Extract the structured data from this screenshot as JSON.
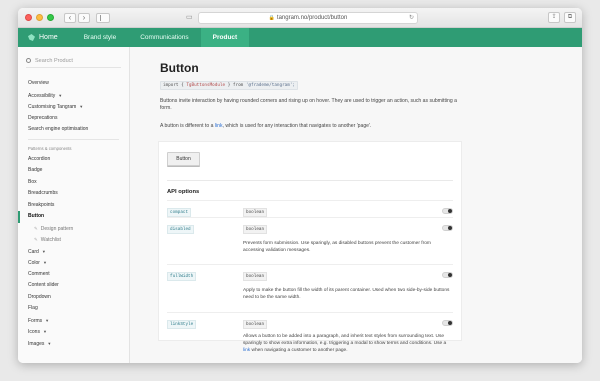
{
  "browser": {
    "url": "tangram.no/product/button"
  },
  "appnav": {
    "items": [
      "Home",
      "Brand style",
      "Communications",
      "Product"
    ],
    "active": "Product"
  },
  "sidebar": {
    "search_placeholder": "Search Product",
    "top_items": [
      "Overview",
      "Accessibility",
      "Customising Tangram",
      "Deprecations",
      "Search engine optimisation"
    ],
    "group_label": "Patterns & components",
    "items": [
      "Accordion",
      "Badge",
      "Box",
      "Breadcrumbs",
      "Breakpoints",
      "Button",
      "Design pattern",
      "Watchlist",
      "Card",
      "Color",
      "Comment",
      "Content slider",
      "Dropdown",
      "Flag",
      "Forms",
      "Icons",
      "Images"
    ]
  },
  "main": {
    "title": "Button",
    "import": {
      "kw1": "import",
      "sep1": "{",
      "module": "TgButtonsModule",
      "sep2": "}",
      "kw2": "from",
      "pkg": "'@frademe/tangram';"
    },
    "desc1": "Buttons invite interaction by having rounded corners and rising up on hover. They are used to trigger an action, such as submitting a form.",
    "desc2_pre": "A button is different to a ",
    "desc2_link": "link",
    "desc2_post": ", which is used for any interaction that navigates to another 'page'.",
    "demo_button": "Button",
    "api_title": "API options",
    "api": [
      {
        "name": "compact",
        "type": "boolean",
        "desc": ""
      },
      {
        "name": "disabled",
        "type": "boolean",
        "desc": "Prevents form submission. Use sparingly, as disabled buttons prevent the customer from accessing validation messages."
      },
      {
        "name": "fullWidth",
        "type": "boolean",
        "desc": "Apply to make the button fill the width of its parent container. Used when two side-by-side buttons need to be the same width."
      },
      {
        "name": "linkStyle",
        "type": "boolean",
        "desc_pre": "Allows a button to be added into a paragraph, and inherit text styles from surrounding text. Use sparingly to show extra information, e.g. triggering a modal to show terms and conditions. Use a ",
        "desc_link": "link",
        "desc_post": " when navigating a customer to another page."
      }
    ]
  }
}
